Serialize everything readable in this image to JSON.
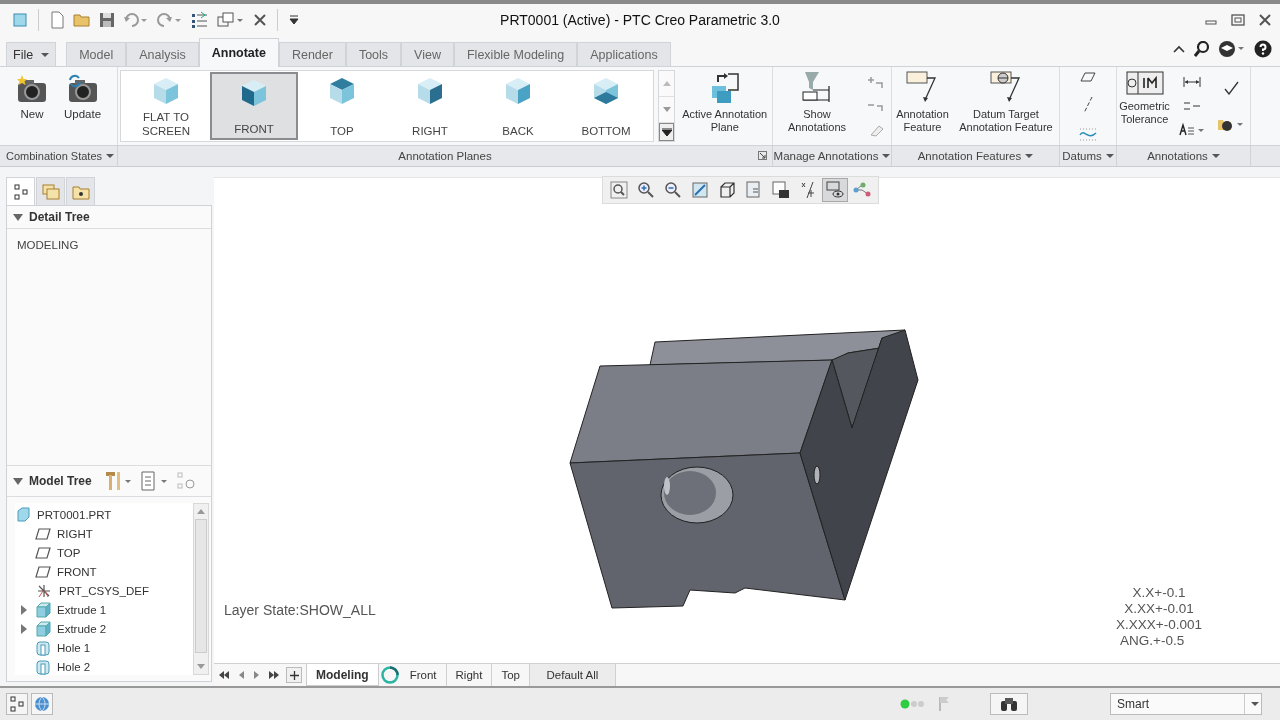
{
  "window": {
    "title": "PRT0001 (Active) - PTC Creo Parametric 3.0"
  },
  "ribbon_tabs": [
    {
      "label": "File",
      "kind": "menu",
      "selected": false
    },
    {
      "label": "Model",
      "kind": "tab",
      "selected": false
    },
    {
      "label": "Analysis",
      "kind": "tab",
      "selected": false
    },
    {
      "label": "Annotate",
      "kind": "tab",
      "selected": true
    },
    {
      "label": "Render",
      "kind": "tab",
      "selected": false
    },
    {
      "label": "Tools",
      "kind": "tab",
      "selected": false
    },
    {
      "label": "View",
      "kind": "tab",
      "selected": false
    },
    {
      "label": "Flexible Modeling",
      "kind": "tab",
      "selected": false
    },
    {
      "label": "Applications",
      "kind": "tab",
      "selected": false
    }
  ],
  "combination_states": {
    "buttons": [
      "New",
      "Update"
    ]
  },
  "annotation_planes": {
    "items": [
      {
        "label": "FLAT TO SCREEN",
        "selected": false
      },
      {
        "label": "FRONT",
        "selected": true
      },
      {
        "label": "TOP",
        "selected": false
      },
      {
        "label": "RIGHT",
        "selected": false
      },
      {
        "label": "BACK",
        "selected": false
      },
      {
        "label": "BOTTOM",
        "selected": false
      }
    ],
    "active_plane_button": "Active Annotation Plane"
  },
  "manage_annotations": {
    "button": "Show Annotations"
  },
  "annotation_features": {
    "buttons": [
      "Annotation Feature",
      "Datum Target Annotation Feature"
    ]
  },
  "annotations": {
    "button": "Geometric Tolerance"
  },
  "group_labels": [
    {
      "label": "Combination States",
      "dropdown": true
    },
    {
      "label": "Annotation Planes",
      "dropdown": false
    },
    {
      "label": "Manage Annotations",
      "dropdown": true
    },
    {
      "label": "Annotation Features",
      "dropdown": true
    },
    {
      "label": "Datums",
      "dropdown": true
    },
    {
      "label": "Annotations",
      "dropdown": true
    }
  ],
  "view_toolbar": [
    {
      "selected": false
    },
    {
      "selected": false
    },
    {
      "selected": false
    },
    {
      "selected": false
    },
    {
      "selected": false
    },
    {
      "selected": false
    },
    {
      "selected": false
    },
    {
      "selected": false
    },
    {
      "selected": true
    },
    {
      "selected": false
    }
  ],
  "navigator_tabs": [
    {
      "selected": true
    },
    {
      "selected": false
    },
    {
      "selected": false
    }
  ],
  "detail_tree": {
    "title": "Detail Tree",
    "expanded": true,
    "items": [
      "MODELING"
    ]
  },
  "model_tree": {
    "title": "Model Tree",
    "expanded": true,
    "items": [
      {
        "label": "PRT0001.PRT",
        "kind": "part"
      },
      {
        "label": "RIGHT",
        "kind": "plane"
      },
      {
        "label": "TOP",
        "kind": "plane"
      },
      {
        "label": "FRONT",
        "kind": "plane"
      },
      {
        "label": "PRT_CSYS_DEF",
        "kind": "csys"
      },
      {
        "label": "Extrude 1",
        "kind": "extrude",
        "expanded": false
      },
      {
        "label": "Extrude 2",
        "kind": "extrude",
        "expanded": false
      },
      {
        "label": "Hole 1",
        "kind": "hole"
      },
      {
        "label": "Hole 2",
        "kind": "hole"
      }
    ]
  },
  "graphics": {
    "layer_state": "Layer State:SHOW_ALL",
    "tolerances": [
      "X.X+-0.1",
      "X.XX+-0.01",
      "X.XXX+-0.001",
      "ANG.+-0.5"
    ]
  },
  "view_tabs": [
    {
      "label": "Modeling",
      "selected": true
    },
    {
      "label": "Front",
      "selected": false
    },
    {
      "label": "Right",
      "selected": false
    },
    {
      "label": "Top",
      "selected": false
    },
    {
      "label": "Default All",
      "selected": false
    }
  ],
  "status_bar": {
    "selection_filter": "Smart"
  }
}
